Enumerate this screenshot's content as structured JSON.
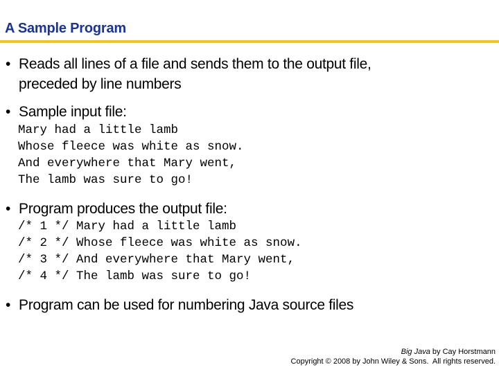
{
  "slide": {
    "title": "A Sample Program",
    "colors": {
      "title": "#1a3399",
      "rule": "#f5c518"
    },
    "bullets": [
      {
        "line1": "Reads all lines of a file and sends them to the output file,",
        "line2": "preceded by line numbers"
      },
      {
        "line1": "Sample input file:"
      },
      {
        "line1": "Program produces the output file:"
      },
      {
        "line1": "Program can be used for numbering Java source files"
      }
    ],
    "input_file": [
      "Mary had a little lamb",
      "Whose fleece was white as snow.",
      "And everywhere that Mary went,",
      "The lamb was sure to go!"
    ],
    "output_file": [
      "/* 1 */ Mary had a little lamb",
      "/* 2 */ Whose fleece was white as snow.",
      "/* 3 */ And everywhere that Mary went,",
      "/* 4 */ The lamb was sure to go!"
    ],
    "bullet_glyph": "•"
  },
  "footer": {
    "book_title": "Big Java",
    "author_text": " by Cay Horstmann",
    "copyright": "Copyright © 2008 by John Wiley & Sons.  All rights reserved."
  }
}
